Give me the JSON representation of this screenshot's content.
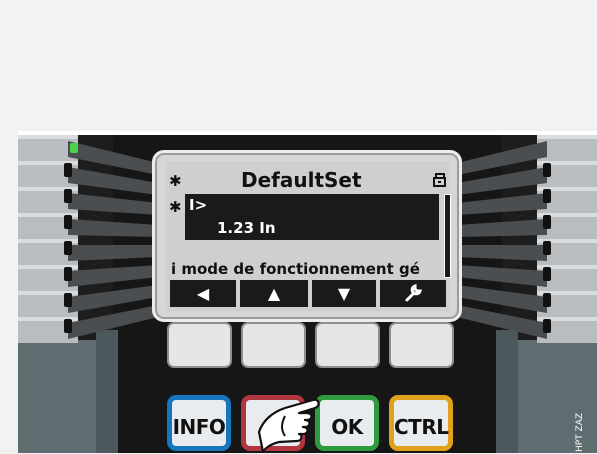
{
  "display": {
    "title": "DefaultSet",
    "star_marker": "✱",
    "selected_param": "I>",
    "param_value": "1.23 In",
    "info_text": "i mode de fonctionnement gé",
    "lock_icon": "unlock-icon",
    "softkeys": [
      {
        "icon": "arrow-left-icon",
        "glyph": "◀"
      },
      {
        "icon": "arrow-up-icon",
        "glyph": "▲"
      },
      {
        "icon": "arrow-down-icon",
        "glyph": "▼"
      },
      {
        "icon": "wrench-icon",
        "glyph": "🔧"
      }
    ]
  },
  "keys": {
    "info": "INFO",
    "c": "C",
    "ok": "OK",
    "ctrl": "CTRL"
  },
  "watermark": "HPT ZAZ",
  "colors": {
    "info_border": "#1576bd",
    "c_border": "#b2363f",
    "ok_border": "#2f9a3f",
    "ctrl_border": "#e2a11c",
    "led": "#4bd34b",
    "bezel": "#1d1d1d"
  }
}
